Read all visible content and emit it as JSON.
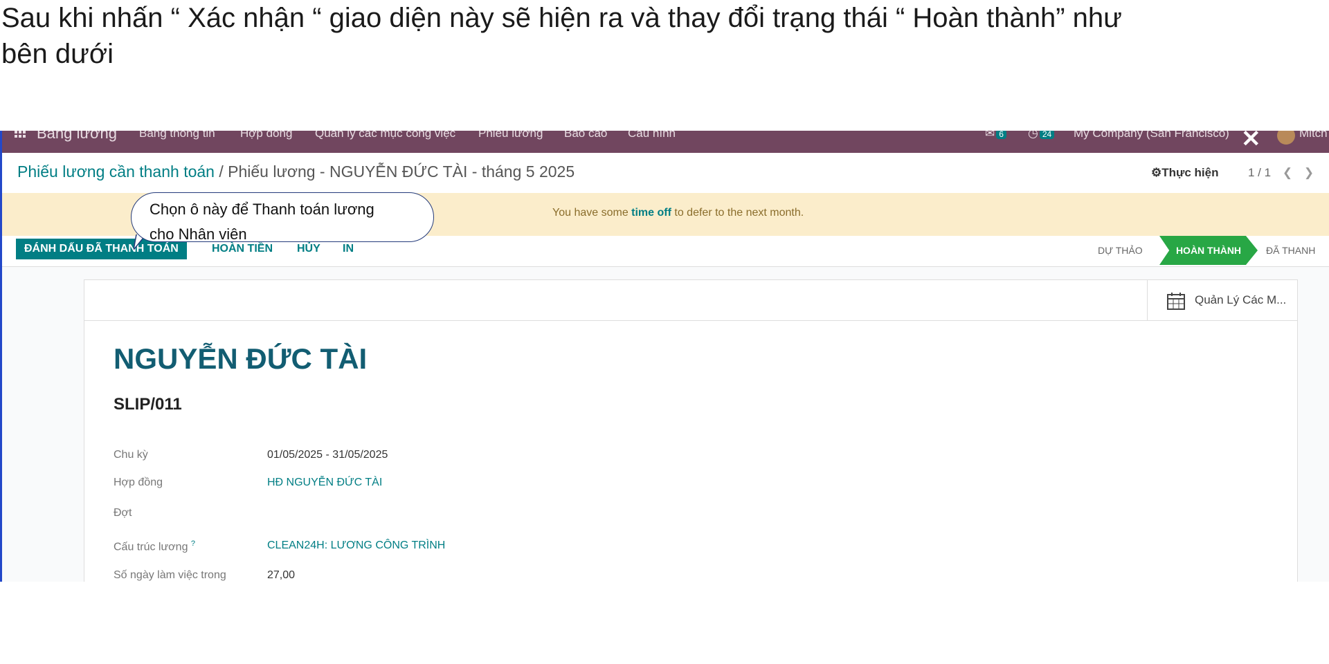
{
  "doc": {
    "line1": "Sau khi nhấn “ Xác nhận “ giao diện này sẽ hiện ra và thay đổi trạng thái “ Hoàn thành”  như",
    "line2": "bên dưới"
  },
  "topbar": {
    "app": "Bảng lương",
    "menu": [
      "Bảng thông tin",
      "Hợp đồng",
      "Quản lý các mục công việc",
      "Phiếu lương",
      "Báo cáo",
      "Cấu hình"
    ],
    "chat_count": "6",
    "activity_count": "24",
    "company": "My Company (San Francisco)",
    "user": "Mitch"
  },
  "breadcrumb": {
    "parent": "Phiếu lương cần thanh toán",
    "separator": " / ",
    "current": "Phiếu lương - NGUYỄN ĐỨC TÀI - tháng 5 2025"
  },
  "gear_button": "Thực hiện",
  "pager": {
    "value": "1 / 1"
  },
  "alert": {
    "before": "You have some ",
    "link": "time off",
    "after": " to defer to the next month."
  },
  "callout": {
    "line1": "Chọn  ô này để Thanh toán lương",
    "line2": "cho Nhân viên"
  },
  "actions": {
    "primary": "ĐÁNH DẤU ĐÃ THANH TOÁN",
    "refund": "HOÀN TIỀN",
    "cancel": "HỦY",
    "print": "IN"
  },
  "statusbar": {
    "draft": "DỰ THẢO",
    "done": "HOÀN THÀNH",
    "paid": "ĐÃ THANH"
  },
  "smart_button": "Quản Lý Các M...",
  "form": {
    "employee": "NGUYỄN ĐỨC TÀI",
    "reference": "SLIP/011",
    "fields": [
      {
        "label": "Chu kỳ",
        "value": "01/05/2025 - 31/05/2025"
      },
      {
        "label": "Hợp đồng",
        "value": "HĐ NGUYỄN ĐỨC TÀI"
      },
      {
        "label": "Đợt",
        "value": ""
      },
      {
        "label": "Cấu trúc lương",
        "help": "?",
        "value": "CLEAN24H: LƯƠNG CÔNG TRÌNH"
      },
      {
        "label": "Số ngày làm việc trong",
        "value": "27,00"
      }
    ]
  },
  "colors": {
    "navbar": "#71465f",
    "accent": "#017e84",
    "done": "#28a745",
    "alert_bg": "#fbedcb"
  }
}
